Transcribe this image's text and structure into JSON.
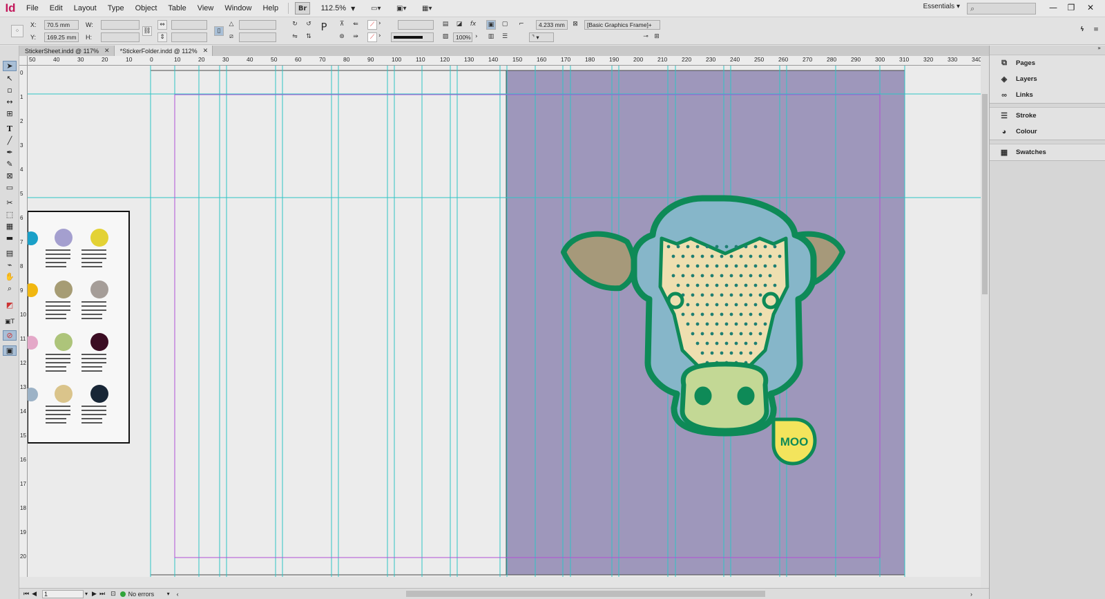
{
  "app": {
    "logo": "Id"
  },
  "menu": [
    "File",
    "Edit",
    "Layout",
    "Type",
    "Object",
    "Table",
    "View",
    "Window",
    "Help"
  ],
  "toolbar": {
    "bridge": "Br",
    "zoom": "112.5%"
  },
  "workspace": "Essentials",
  "control_panel": {
    "x_label": "X:",
    "x_value": "70.5 mm",
    "y_label": "Y:",
    "y_value": "169.25 mm",
    "w_label": "W:",
    "h_label": "H:",
    "stroke_weight": "4.233 mm",
    "opacity": "100%",
    "object_style": "[Basic Graphics Frame]+"
  },
  "tabs": [
    {
      "label": "StickerSheet.indd @ 117%"
    },
    {
      "label": "*StickerFolder.indd @ 112%"
    }
  ],
  "ruler_top": [
    "50",
    "40",
    "30",
    "20",
    "10",
    "0",
    "10",
    "20",
    "30",
    "40",
    "50",
    "60",
    "70",
    "80",
    "90",
    "100",
    "110",
    "120",
    "130",
    "140",
    "150",
    "160",
    "170",
    "180",
    "190",
    "200",
    "210",
    "220",
    "230",
    "240",
    "250",
    "260",
    "270",
    "280",
    "290",
    "300",
    "310",
    "320",
    "330",
    "340"
  ],
  "ruler_left": [
    "0",
    "1",
    "2",
    "3",
    "4",
    "5",
    "6",
    "7",
    "8",
    "9",
    "10",
    "11",
    "12",
    "13",
    "14",
    "15",
    "16",
    "17",
    "18",
    "19",
    "20"
  ],
  "artwork": {
    "moo_tag": "MOO"
  },
  "status": {
    "page": "1",
    "errors": "No errors"
  },
  "panels": {
    "group1": [
      {
        "label": "Pages",
        "icon": "pages-icon"
      },
      {
        "label": "Layers",
        "icon": "layers-icon"
      },
      {
        "label": "Links",
        "icon": "links-icon"
      }
    ],
    "group2": [
      {
        "label": "Stroke",
        "icon": "stroke-icon"
      },
      {
        "label": "Colour",
        "icon": "colour-icon"
      }
    ],
    "group3": [
      {
        "label": "Swatches",
        "icon": "swatches-icon"
      }
    ]
  },
  "colors": {
    "accent": "#c2185b",
    "spread": "#9e97bb",
    "guide": "#2ec4c4",
    "margin": "#b14fd6",
    "cow_green": "#0e8a57",
    "tag_yellow": "#f3e45c"
  }
}
